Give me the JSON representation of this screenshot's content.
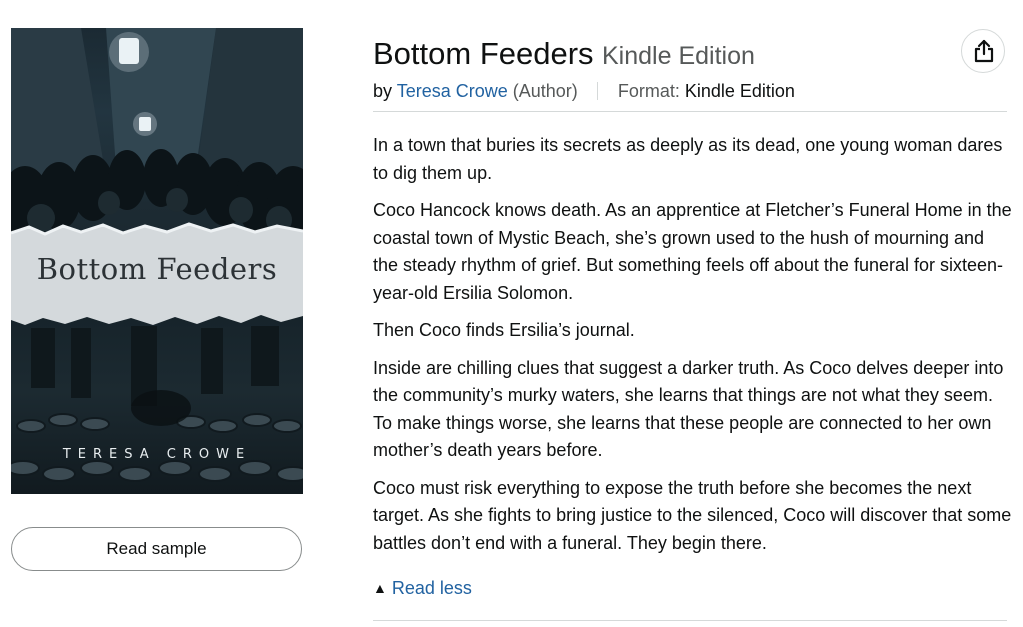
{
  "cover": {
    "title": "Bottom Feeders",
    "author": "TERESA CROWE"
  },
  "sample": {
    "label": "Read sample"
  },
  "product": {
    "title": "Bottom Feeders",
    "edition": "Kindle Edition",
    "by_prefix": "by",
    "author": "Teresa Crowe",
    "author_role": "(Author)",
    "format_label": "Format:",
    "format_value": "Kindle Edition"
  },
  "share": {
    "icon": "share-icon"
  },
  "description": {
    "paragraphs": [
      "In a town that buries its secrets as deeply as its dead, one young woman dares to dig them up.",
      "Coco Hancock knows death. As an apprentice at Fletcher’s Funeral Home in the coastal town of Mystic Beach, she’s grown used to the hush of mourning and the steady rhythm of grief. But something feels off about the funeral for sixteen-year-old Ersilia Solomon.",
      "Then Coco finds Ersilia’s journal.",
      "Inside are chilling clues that suggest a darker truth. As Coco delves deeper into the community’s murky waters, she learns that things are not what they seem. To make things worse, she learns that these people are connected to her own mother’s death years before.",
      "Coco must risk everything to expose the truth before she becomes the next target. As she fights to bring justice to the silenced, Coco will discover that some battles don’t end with a funeral. They begin there."
    ],
    "read_less": "Read less",
    "caret_icon": "caret-up-icon"
  },
  "colors": {
    "link": "#2162a1",
    "text": "#0f1111",
    "muted": "#565959",
    "divider": "#d5d9d9"
  }
}
